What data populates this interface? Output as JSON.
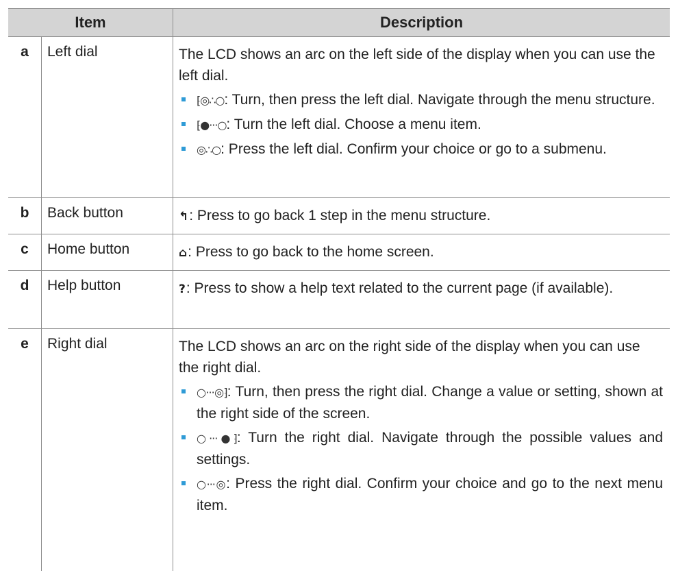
{
  "header": {
    "item": "Item",
    "description": "Description"
  },
  "rows": [
    {
      "key": "a",
      "item": "Left dial",
      "intro": "The LCD shows an arc on the left side of the display when you can use the left dial.",
      "bullets": [
        {
          "symbol": "⁅◎∴○",
          "text": ": Turn, then press the left dial. Navigate through the menu structure."
        },
        {
          "symbol": "⁅●···○",
          "text": ": Turn the left dial. Choose a menu item."
        },
        {
          "symbol": "◎∴○",
          "text": ": Press the left dial. Confirm your choice or go to a submenu."
        }
      ]
    },
    {
      "key": "b",
      "item": "Back button",
      "icon": "↰",
      "text": ": Press to go back 1 step in the menu structure."
    },
    {
      "key": "c",
      "item": "Home button",
      "icon": "⌂",
      "text": ": Press to go back to the home screen."
    },
    {
      "key": "d",
      "item": "Help button",
      "icon": "?",
      "text": ": Press to show a help text related to the current page (if available)."
    },
    {
      "key": "e",
      "item": "Right dial",
      "intro": "The LCD shows an arc on the right side of the display when you can use the right dial.",
      "bullets": [
        {
          "symbol": "○···◎⁆",
          "text": ": Turn, then press the right dial. Change a value or setting, shown at the right side of the screen."
        },
        {
          "symbol": "○···●⁆",
          "text": ": Turn the right dial. Navigate through the possible values and settings."
        },
        {
          "symbol": "○···◎",
          "text": ": Press the right dial. Confirm your choice and go to the next menu item."
        }
      ]
    }
  ]
}
